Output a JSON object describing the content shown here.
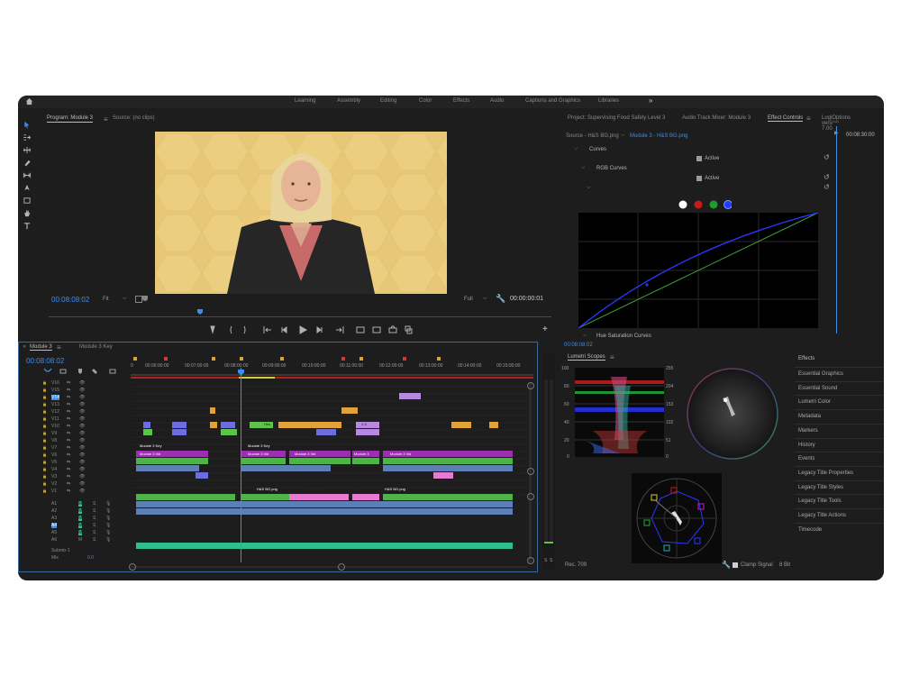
{
  "workspaces": {
    "items": [
      "Learning",
      "Assembly",
      "Editing",
      "Color",
      "Effects",
      "Audio",
      "Captions and Graphics",
      "Libraries"
    ],
    "more": "»"
  },
  "program": {
    "tab_program": "Program: Module 3",
    "tab_source": "Source: (no clips)",
    "timecode": "00:08:08:02",
    "fit": "Fit",
    "full": "Full",
    "duration": "00:00:00:01"
  },
  "project_panel": {
    "tab_project": "Project: Supervising Food Safety Level 3",
    "tab_mixer": "Audio Track Mixer: Module 3",
    "tab_effects": "Effect Controls",
    "tab_logi": "LogiOptions version 7.00.5",
    "source": "Source - H&S BG.png",
    "clip": "Module 3 - H&S BG.png",
    "curves": "Curves",
    "active1": "Active",
    "rgb_curves": "RGB Curves",
    "active2": "Active",
    "hue_sat": "Hue Saturation Curves",
    "ec_timecode": "00:08:30:00",
    "bottom_timecode": "00:08:08:02"
  },
  "timeline": {
    "tab_module3": "Module 3",
    "tab_module3_key": "Module 3 Key",
    "timecode": "00:08:08:02",
    "ruler": [
      "0",
      "00:06:00:00",
      "00:07:00:00",
      "00:08:00:00",
      "00:09:00:00",
      "00:10:00:00",
      "00:11:00:00",
      "00:12:00:00",
      "00:13:00:00",
      "00:14:00:00",
      "00:15:00:00"
    ],
    "video_tracks": [
      "V16",
      "V15",
      "V14",
      "V13",
      "V12",
      "V11",
      "V10",
      "V9",
      "V8",
      "V7",
      "V6",
      "V5",
      "V4",
      "V3",
      "V2",
      "V1"
    ],
    "audio_tracks": [
      "A1",
      "A2",
      "A3",
      "A4",
      "A5",
      "A6"
    ],
    "submix": "Submix 1",
    "mix": "Mix",
    "mix_value": "0.0",
    "clip_labels": {
      "module3_key": "Module 3 Key",
      "module3_vid": "Module 3 Vid",
      "hs": "H&S",
      "hs_bg": "H&S BG.png",
      "bg_png": "1-2 BG.png",
      "mod3": "Module 3",
      "k12": "1-2",
      "k1s": "1-S",
      "hes": "Hes"
    }
  },
  "scopes": {
    "tab": "Lumetri Scopes",
    "left_ticks": [
      "100",
      "80",
      "60",
      "40",
      "20",
      "0"
    ],
    "right_ticks": [
      "255",
      "204",
      "153",
      "102",
      "51",
      "0"
    ],
    "rec": "Rec. 709",
    "clamp": "Clamp Signal",
    "bit": "8 Bit"
  },
  "effects_list": {
    "title": "Effects",
    "items": [
      "Essential Graphics",
      "Essential Sound",
      "Lumetri Color",
      "Metadata",
      "Markers",
      "History",
      "Events",
      "Legacy Title Properties",
      "Legacy Title Styles",
      "Legacy Title Tools",
      "Legacy Title Actions",
      "Timecode"
    ]
  },
  "meter": {
    "s1": "S",
    "s2": "S"
  }
}
